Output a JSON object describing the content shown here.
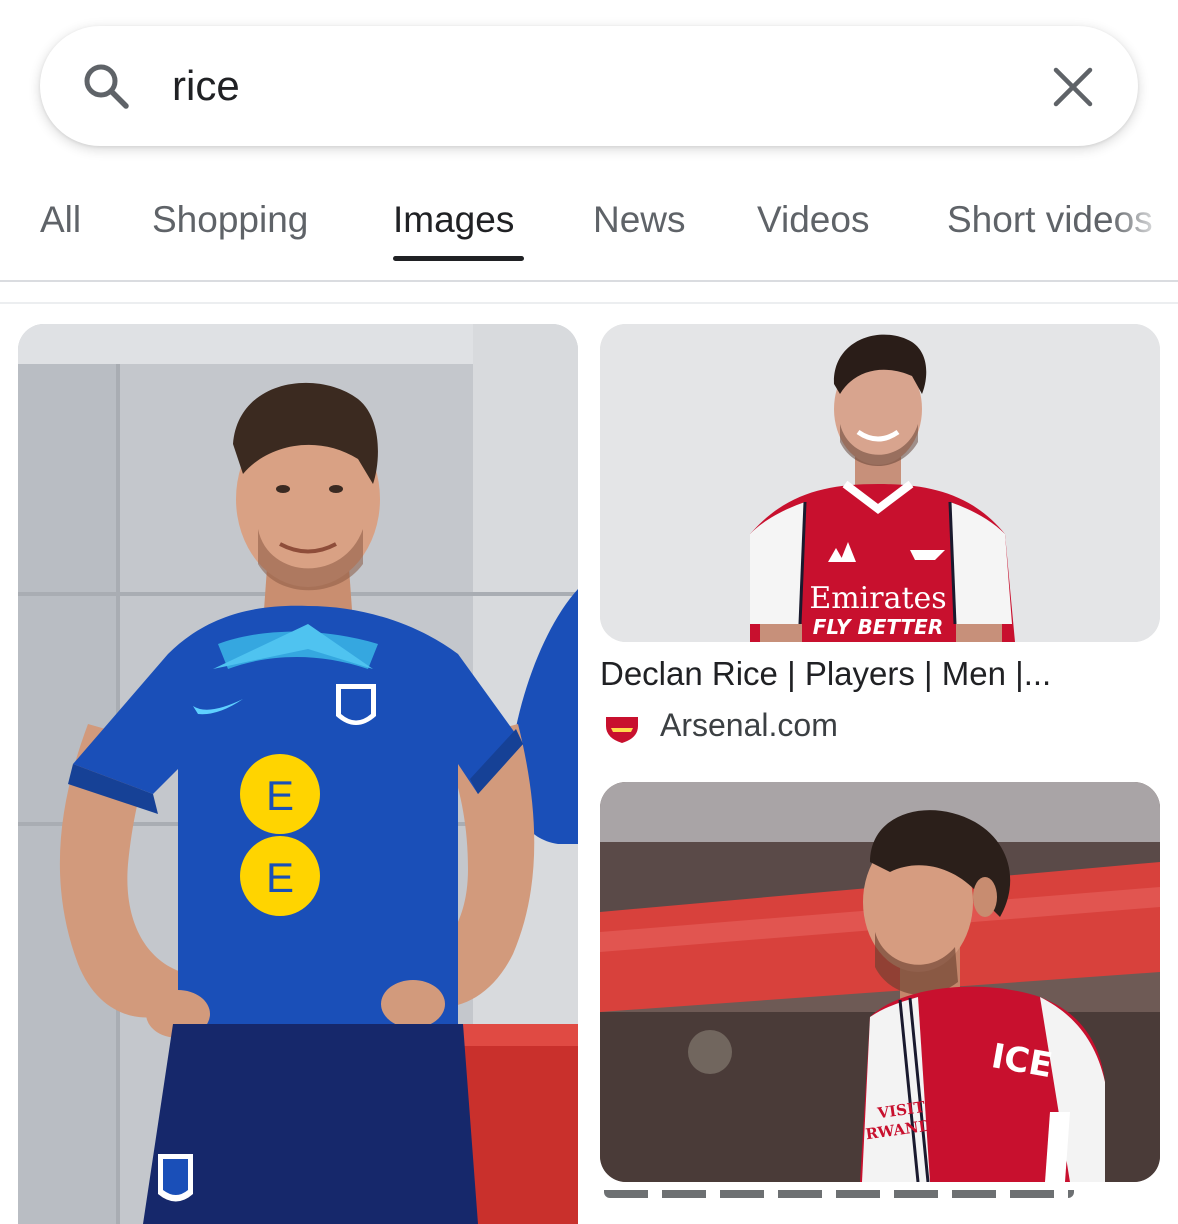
{
  "search": {
    "query": "rice",
    "search_icon": "search-icon",
    "clear_icon": "close-icon"
  },
  "tabs": [
    {
      "label": "All",
      "active": false
    },
    {
      "label": "Shopping",
      "active": false
    },
    {
      "label": "Images",
      "active": true
    },
    {
      "label": "News",
      "active": false
    },
    {
      "label": "Videos",
      "active": false
    },
    {
      "label": "Short videos",
      "active": false
    }
  ],
  "results": [
    {
      "kind": "image",
      "subject": "england-training-photo"
    },
    {
      "kind": "image",
      "subject": "arsenal-portrait-photo",
      "title": "Declan Rice | Players | Men |...",
      "source": "Arsenal.com",
      "favicon": "arsenal-crest-icon",
      "jersey_text": [
        "Emirates",
        "FLY BETTER"
      ]
    },
    {
      "kind": "image",
      "subject": "arsenal-match-photo",
      "jersey_text": [
        "ICE",
        "VISIT",
        "RWANDA"
      ]
    }
  ],
  "colors": {
    "text_primary": "#202124",
    "text_secondary": "#5f6368",
    "active_underline": "#202124",
    "england_blue": "#1a4fb8",
    "arsenal_red": "#c8102e",
    "ee_yellow": "#ffd400"
  }
}
